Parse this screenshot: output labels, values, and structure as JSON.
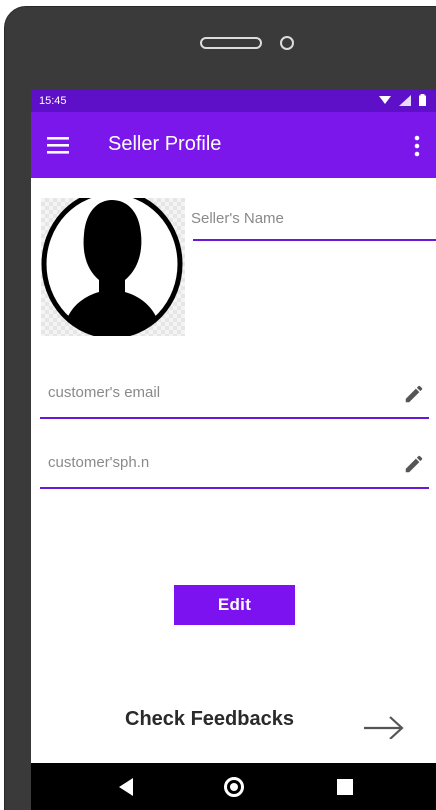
{
  "status_bar": {
    "time": "15:45",
    "icons": [
      "wifi-icon",
      "signal-icon",
      "battery-icon"
    ]
  },
  "app_bar": {
    "title": "Seller Profile",
    "menu_icon": "hamburger-menu-icon",
    "overflow_icon": "more-vert-icon"
  },
  "profile": {
    "avatar_icon": "person-silhouette-icon",
    "name_placeholder": "Seller's Name"
  },
  "fields": [
    {
      "placeholder": "customer's email",
      "icon": "pencil-icon"
    },
    {
      "placeholder": "customer'sph.n",
      "icon": "pencil-icon"
    }
  ],
  "edit_button_label": "Edit",
  "feedback": {
    "label": "Check Feedbacks",
    "icon": "arrow-right-icon"
  },
  "nav_bar": {
    "icons": [
      "back-icon",
      "home-icon",
      "recents-icon"
    ]
  },
  "colors": {
    "status_bar": "#5e10c8",
    "app_bar": "#7b17ea",
    "accent": "#7d12f0",
    "underline": "#6a18d8",
    "phone_frame": "#3a3a3a"
  }
}
